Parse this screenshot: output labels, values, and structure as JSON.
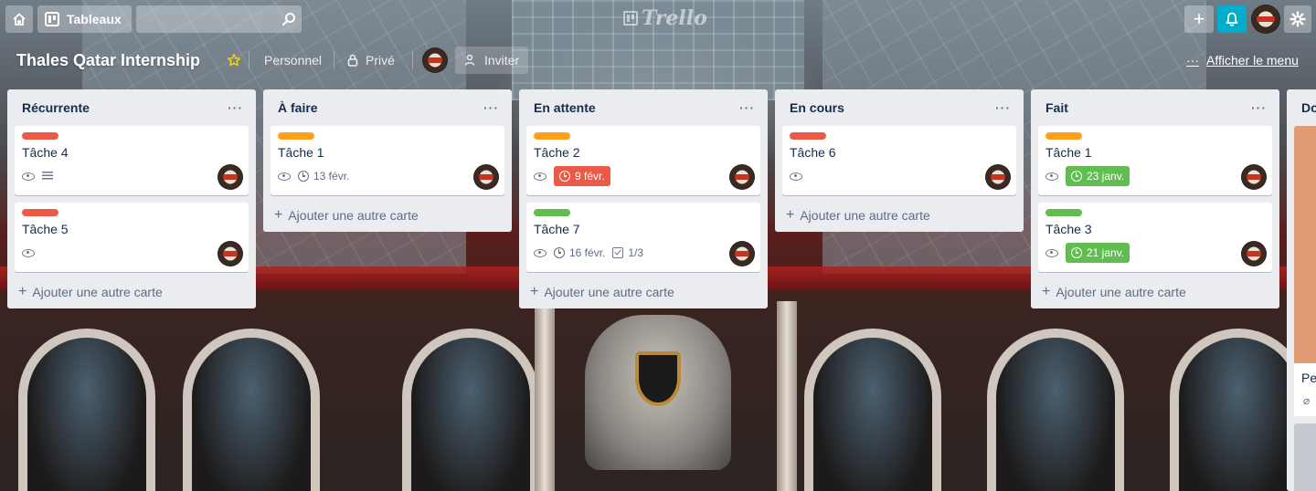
{
  "header": {
    "boards_label": "Tableaux",
    "search_value": "",
    "add_label": "+"
  },
  "board": {
    "title": "Thales Qatar Internship",
    "visibility_team": "Personnel",
    "visibility_privacy": "Privé",
    "invite_label": "Inviter",
    "menu_label": "Afficher le menu",
    "menu_dots": "···"
  },
  "brand": {
    "logo_text": "Trello"
  },
  "colors": {
    "label_red": "#eb5a46",
    "label_orange": "#ff9f1a",
    "label_green": "#61bd4f",
    "due_overdue": "#eb5a46",
    "due_complete": "#61bd4f",
    "notification": "#00aecc"
  },
  "add_card_label": "Ajouter une autre carte",
  "list_menu": "···",
  "lists": [
    {
      "title": "Récurrente",
      "cards": [
        {
          "label_color": "#eb5a46",
          "title": "Tâche 4",
          "watch": true,
          "description": true
        },
        {
          "label_color": "#eb5a46",
          "title": "Tâche 5",
          "watch": true
        }
      ]
    },
    {
      "title": "À faire",
      "cards": [
        {
          "label_color": "#ff9f1a",
          "title": "Tâche 1",
          "watch": true,
          "due": "13 févr.",
          "due_state": "normal"
        }
      ]
    },
    {
      "title": "En attente",
      "cards": [
        {
          "label_color": "#ff9f1a",
          "title": "Tâche 2",
          "watch": true,
          "due": "9 févr.",
          "due_state": "overdue"
        },
        {
          "label_color": "#61bd4f",
          "title": "Tâche 7",
          "watch": true,
          "due": "16 févr.",
          "due_state": "normal",
          "checklist": "1/3"
        }
      ]
    },
    {
      "title": "En cours",
      "cards": [
        {
          "label_color": "#eb5a46",
          "title": "Tâche 6",
          "watch": true
        }
      ]
    },
    {
      "title": "Fait",
      "cards": [
        {
          "label_color": "#ff9f1a",
          "title": "Tâche 1",
          "watch": true,
          "due": "23 janv.",
          "due_state": "complete"
        },
        {
          "label_color": "#61bd4f",
          "title": "Tâche 3",
          "watch": true,
          "due": "21 janv.",
          "due_state": "complete"
        }
      ]
    }
  ],
  "partial_list": {
    "title": "Do",
    "card_title": "Pe"
  }
}
